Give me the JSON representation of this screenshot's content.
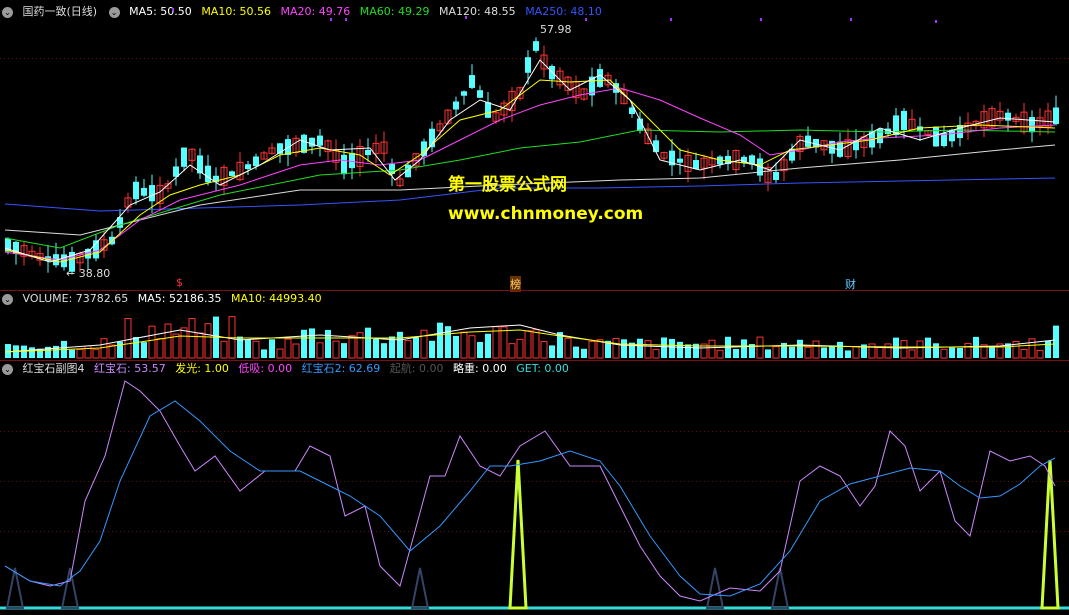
{
  "main": {
    "title": "国药一致(日线)",
    "ma": [
      {
        "label": "MA5: 50.50",
        "color": "#ffffff"
      },
      {
        "label": "MA10: 50.56",
        "color": "#ffff00"
      },
      {
        "label": "MA20: 49.76",
        "color": "#ff44ff"
      },
      {
        "label": "MA60: 49.29",
        "color": "#22dd22"
      },
      {
        "label": "MA120: 48.55",
        "color": "#dddddd"
      },
      {
        "label": "MA250: 48.10",
        "color": "#3355ff"
      }
    ],
    "high_marker": "57.98",
    "low_marker": "← 38.80",
    "events": [
      {
        "label": "$",
        "color": "#ff3333"
      },
      {
        "label": "榜",
        "color": "#ffcc66"
      },
      {
        "label": "财",
        "color": "#66ccff"
      }
    ],
    "watermark_line1": "第一股票公式网",
    "watermark_line2": "www.chnmoney.com"
  },
  "volume": {
    "label": "VOLUME: 73782.65",
    "ma5": "MA5: 52186.35",
    "ma10": "MA10: 44993.40"
  },
  "indicator": {
    "title": "红宝石副图4",
    "items": [
      {
        "label": "红宝石: 53.57",
        "color": "#cc88ff"
      },
      {
        "label": "发光: 1.00",
        "color": "#ffff00"
      },
      {
        "label": "低吸: 0.00",
        "color": "#ff44ff"
      },
      {
        "label": "红宝石2: 62.69",
        "color": "#3399ff"
      },
      {
        "label": "起航: 0.00",
        "color": "#555555"
      },
      {
        "label": "略重: 0.00",
        "color": "#ffffff"
      },
      {
        "label": "GET: 0.00",
        "color": "#33dddd"
      }
    ]
  },
  "colors": {
    "up": "#ff3333",
    "down": "#55ffff",
    "ruby": "#cc88ff",
    "ruby2": "#3399ff",
    "glow": "#ccff33",
    "qihang": "#334466"
  }
}
